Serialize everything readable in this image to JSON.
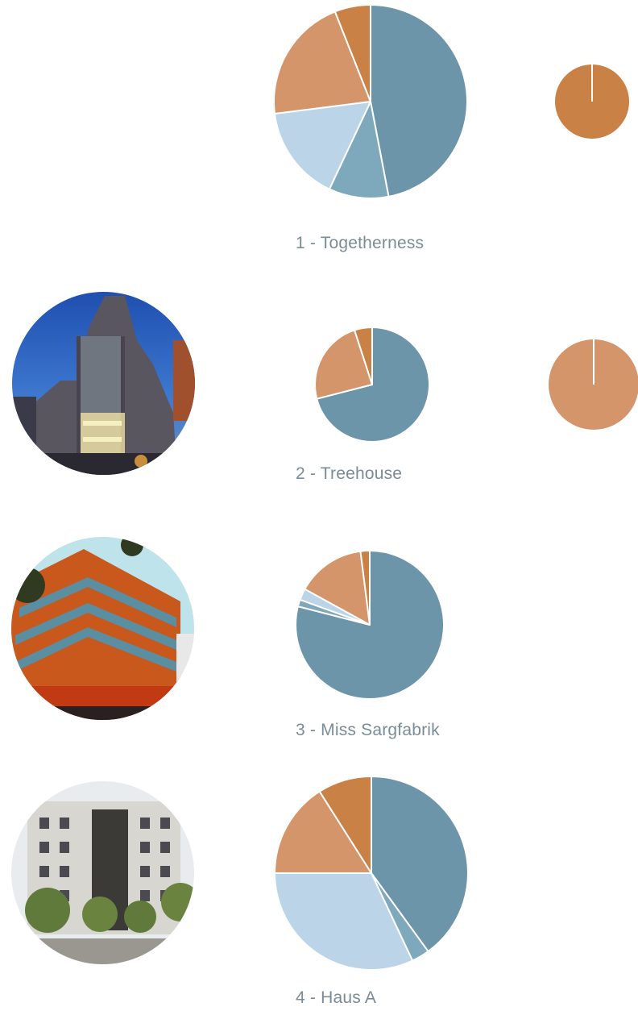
{
  "colors": {
    "steel_blue": "#6d95aa",
    "mid_blue": "#7ea8bc",
    "light_blue": "#bcd4e8",
    "sand": "#d4956a",
    "copper": "#c98145"
  },
  "projects": [
    {
      "label": "1 - Togetherness",
      "photo": null
    },
    {
      "label": "2 - Treehouse",
      "photo": "treehouse-building-photo"
    },
    {
      "label": "3 - Miss Sargfabrik",
      "photo": "miss-sargfabrik-building-photo"
    },
    {
      "label": "4 - Haus A",
      "photo": "haus-a-building-photo"
    }
  ],
  "chart_data": [
    {
      "type": "pie",
      "project": "1 - Togetherness",
      "chart": "main",
      "slices": [
        {
          "value": 47,
          "color": "#6d95aa"
        },
        {
          "value": 10,
          "color": "#7ea8bc"
        },
        {
          "value": 16,
          "color": "#bcd4e8"
        },
        {
          "value": 21,
          "color": "#d4956a"
        },
        {
          "value": 6,
          "color": "#c98145"
        }
      ]
    },
    {
      "type": "pie",
      "project": "1 - Togetherness",
      "chart": "secondary",
      "slices": [
        {
          "value": 100,
          "color": "#c98145"
        }
      ]
    },
    {
      "type": "pie",
      "project": "2 - Treehouse",
      "chart": "main",
      "slices": [
        {
          "value": 71,
          "color": "#6d95aa"
        },
        {
          "value": 24,
          "color": "#d4956a"
        },
        {
          "value": 5,
          "color": "#c98145"
        }
      ]
    },
    {
      "type": "pie",
      "project": "2 - Treehouse",
      "chart": "secondary",
      "slices": [
        {
          "value": 100,
          "color": "#d4956a"
        }
      ]
    },
    {
      "type": "pie",
      "project": "3 - Miss Sargfabrik",
      "chart": "main",
      "slices": [
        {
          "value": 79,
          "color": "#6d95aa"
        },
        {
          "value": 1.5,
          "color": "#7ea8bc"
        },
        {
          "value": 2.5,
          "color": "#bcd4e8"
        },
        {
          "value": 15,
          "color": "#d4956a"
        },
        {
          "value": 2,
          "color": "#c98145"
        }
      ]
    },
    {
      "type": "pie",
      "project": "4 - Haus A",
      "chart": "main",
      "slices": [
        {
          "value": 40,
          "color": "#6d95aa"
        },
        {
          "value": 3,
          "color": "#7ea8bc"
        },
        {
          "value": 32,
          "color": "#bcd4e8"
        },
        {
          "value": 16,
          "color": "#d4956a"
        },
        {
          "value": 9,
          "color": "#c98145"
        }
      ]
    }
  ]
}
